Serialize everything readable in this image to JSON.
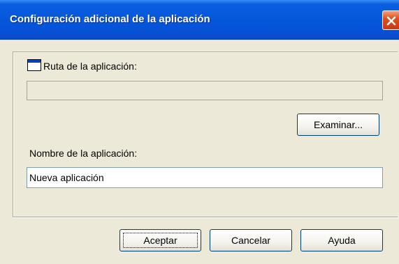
{
  "window": {
    "title": "Configuración adicional de la aplicación"
  },
  "ruta": {
    "label": "Ruta de la aplicación:",
    "value": "",
    "icon": "app-window-icon"
  },
  "buttons": {
    "examinar": "Examinar...",
    "aceptar": "Aceptar",
    "cancelar": "Cancelar",
    "ayuda": "Ayuda"
  },
  "nombre": {
    "label": "Nombre de la aplicación:",
    "value": "Nueva aplicación"
  },
  "colors": {
    "titlebar": "#0553d8",
    "window_bg": "#ece9d8",
    "close_button": "#e0501e"
  }
}
